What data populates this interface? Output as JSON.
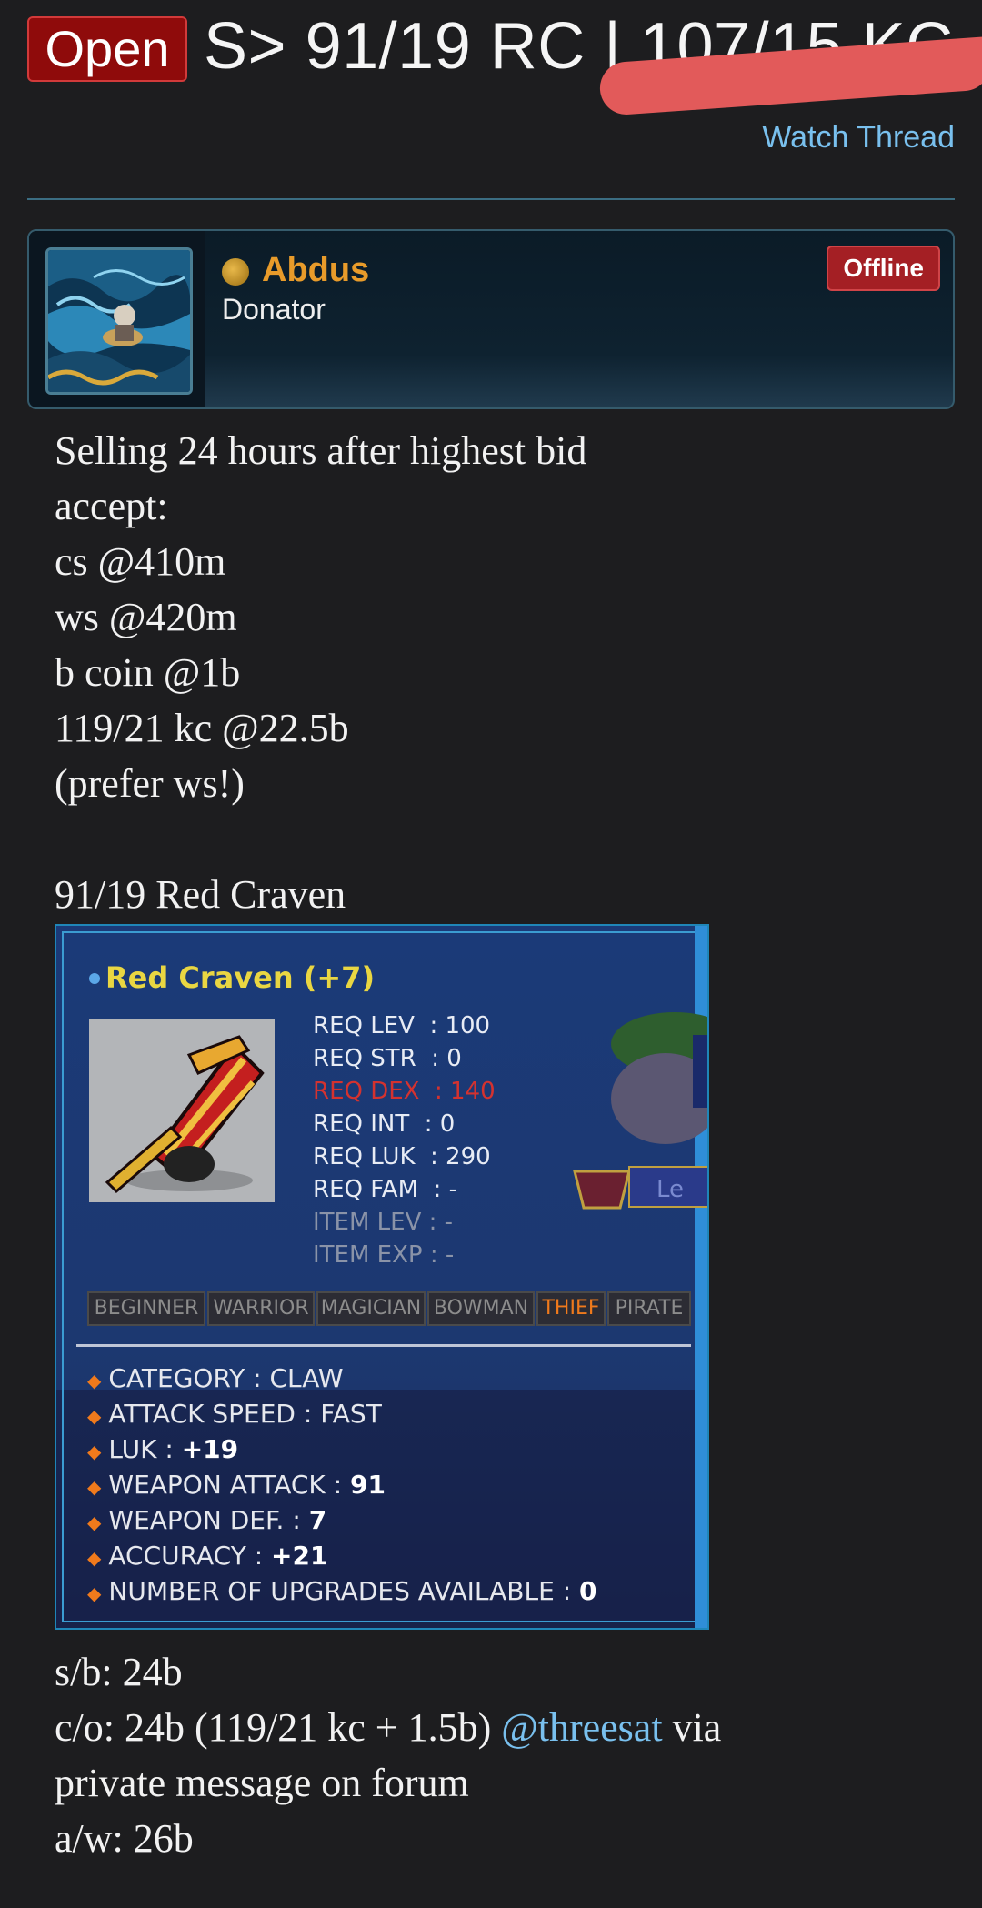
{
  "thread": {
    "prefix": "Open",
    "title": "S> 91/19 RC | 107/15 KC",
    "watch_label": "Watch Thread"
  },
  "author": {
    "name": "Abdus",
    "title": "Donator",
    "status": "Offline"
  },
  "post": {
    "intro_lines": [
      "Selling 24 hours after highest bid",
      "accept:",
      "cs @410m",
      "ws @420m",
      "b coin @1b",
      "119/21 kc @22.5b",
      "(prefer ws!)"
    ],
    "item_heading": "91/19 Red Craven",
    "sb": "s/b: 24b",
    "co_prefix": "c/o: 24b (119/21 kc + 1.5b) ",
    "co_mention": "@threesat",
    "co_suffix": " via",
    "co_line2": "private message on forum",
    "aw": "a/w: 26b"
  },
  "item": {
    "name": "Red Craven (+7)",
    "requirements": [
      {
        "label": "REQ LEV",
        "value": "100",
        "style": "normal"
      },
      {
        "label": "REQ STR",
        "value": "0",
        "style": "normal"
      },
      {
        "label": "REQ DEX",
        "value": "140",
        "style": "red"
      },
      {
        "label": "REQ INT",
        "value": "0",
        "style": "normal"
      },
      {
        "label": "REQ LUK",
        "value": "290",
        "style": "normal"
      },
      {
        "label": "REQ FAM",
        "value": "-",
        "style": "normal"
      },
      {
        "label": "ITEM LEV",
        "value": "-",
        "style": "dim"
      },
      {
        "label": "ITEM EXP",
        "value": "-",
        "style": "dim"
      }
    ],
    "jobs": [
      {
        "name": "BEGINNER",
        "active": false
      },
      {
        "name": "WARRIOR",
        "active": false
      },
      {
        "name": "MAGICIAN",
        "active": false
      },
      {
        "name": "BOWMAN",
        "active": false
      },
      {
        "name": "THIEF",
        "active": true
      },
      {
        "name": "PIRATE",
        "active": false
      }
    ],
    "stats": [
      {
        "label": "CATEGORY",
        "value": "CLAW",
        "bold": false
      },
      {
        "label": "ATTACK SPEED",
        "value": "FAST",
        "bold": false
      },
      {
        "label": "LUK",
        "value": "+19",
        "bold": true
      },
      {
        "label": "WEAPON ATTACK",
        "value": "91",
        "bold": true
      },
      {
        "label": "WEAPON DEF.",
        "value": "7",
        "bold": true
      },
      {
        "label": "ACCURACY",
        "value": "+21",
        "bold": true
      },
      {
        "label": "NUMBER OF UPGRADES AVAILABLE",
        "value": "0",
        "bold": true
      }
    ],
    "side_text": "Le"
  },
  "colors": {
    "accent_link": "#79c0ee",
    "username": "#e89b2a",
    "prefix_bg": "#8f0b0b",
    "offline_bg": "#a41f24"
  }
}
